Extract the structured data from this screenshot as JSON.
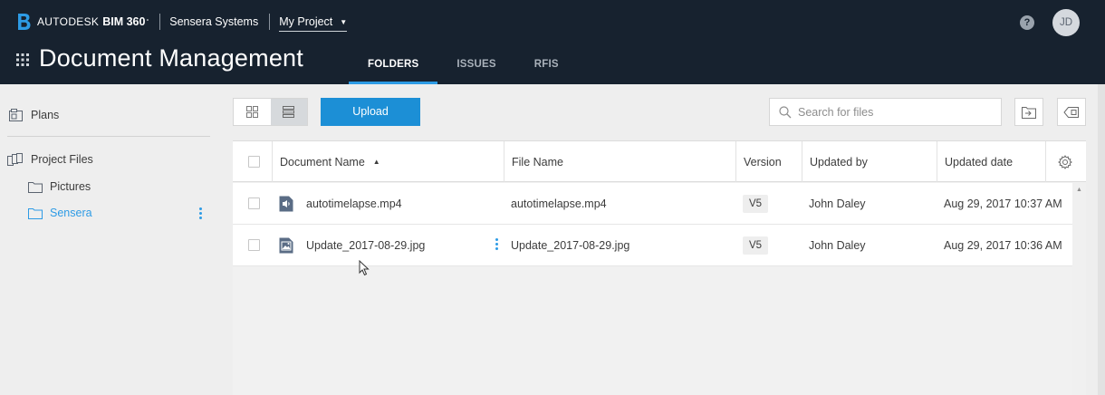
{
  "header": {
    "brand_autodesk": "AUTODESK",
    "brand_product": "BIM 360",
    "brand_tm": "°",
    "company": "Sensera Systems",
    "project": "My Project",
    "help_glyph": "?",
    "avatar_initials": "JD",
    "page_title": "Document Management",
    "tabs": [
      {
        "label": "FOLDERS",
        "active": true
      },
      {
        "label": "ISSUES",
        "active": false
      },
      {
        "label": "RFIS",
        "active": false
      }
    ]
  },
  "sidebar": {
    "plans": "Plans",
    "project_files": "Project Files",
    "folders": [
      {
        "label": "Pictures",
        "active": false
      },
      {
        "label": "Sensera",
        "active": true
      }
    ]
  },
  "toolbar": {
    "upload_label": "Upload",
    "search_placeholder": "Search for files"
  },
  "table": {
    "columns": {
      "document_name": "Document Name",
      "file_name": "File Name",
      "version": "Version",
      "updated_by": "Updated by",
      "updated_date": "Updated date"
    },
    "rows": [
      {
        "doc_name": "autotimelapse.mp4",
        "file_name": "autotimelapse.mp4",
        "version": "V5",
        "updated_by": "John Daley",
        "updated_date": "Aug 29, 2017 10:37 AM",
        "icon": "video-file-icon"
      },
      {
        "doc_name": "Update_2017-08-29.jpg",
        "file_name": "Update_2017-08-29.jpg",
        "version": "V5",
        "updated_by": "John Daley",
        "updated_date": "Aug 29, 2017 10:36 AM",
        "icon": "image-file-icon"
      }
    ]
  },
  "colors": {
    "header_bg": "#17222f",
    "accent": "#2d9be5",
    "upload": "#1c8fd6"
  }
}
